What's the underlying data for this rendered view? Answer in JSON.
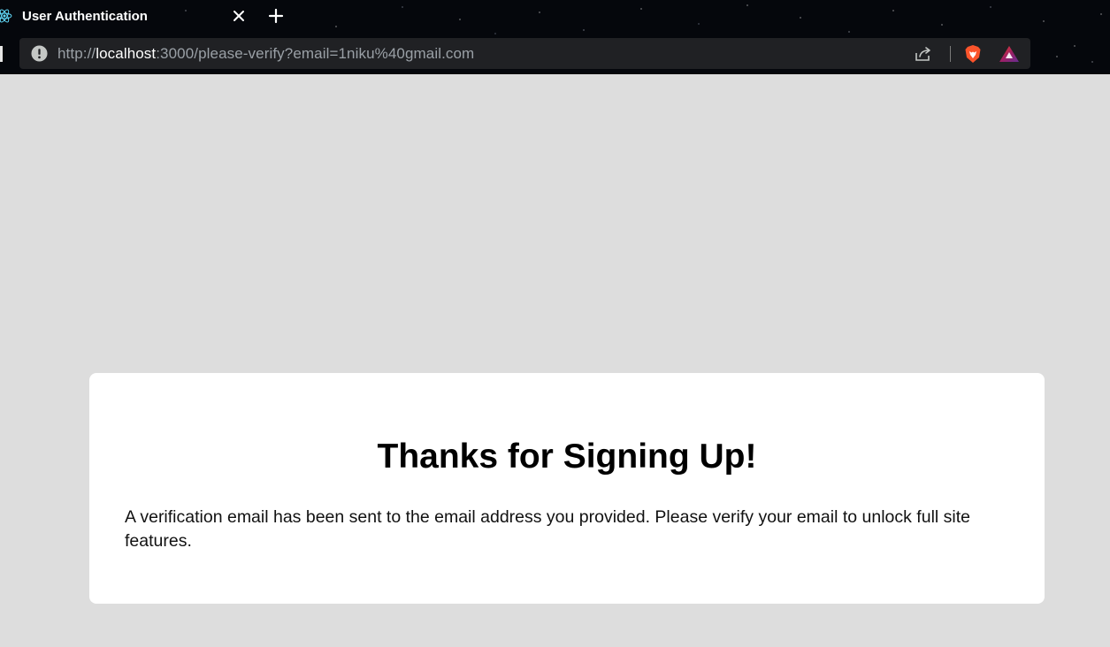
{
  "browser": {
    "tab": {
      "title": "User Authentication",
      "favicon": "react-logo-icon"
    },
    "address_bar": {
      "scheme": "http://",
      "host": "localhost",
      "rest": ":3000/please-verify?email=1niku%40gmail.com",
      "security_icon": "info-warning-icon"
    },
    "toolbar_icons": [
      "share-icon",
      "brave-shields-icon",
      "brave-rewards-icon"
    ]
  },
  "page": {
    "heading": "Thanks for Signing Up!",
    "message": "A verification email has been sent to the email address you provided. Please verify your email to unlock full site features."
  },
  "colors": {
    "page_background": "#dddddd",
    "card_background": "#ffffff",
    "chrome_background": "#05070c",
    "address_bar": "#202124",
    "brave_orange": "#fb542b",
    "react_cyan": "#61dafb"
  }
}
